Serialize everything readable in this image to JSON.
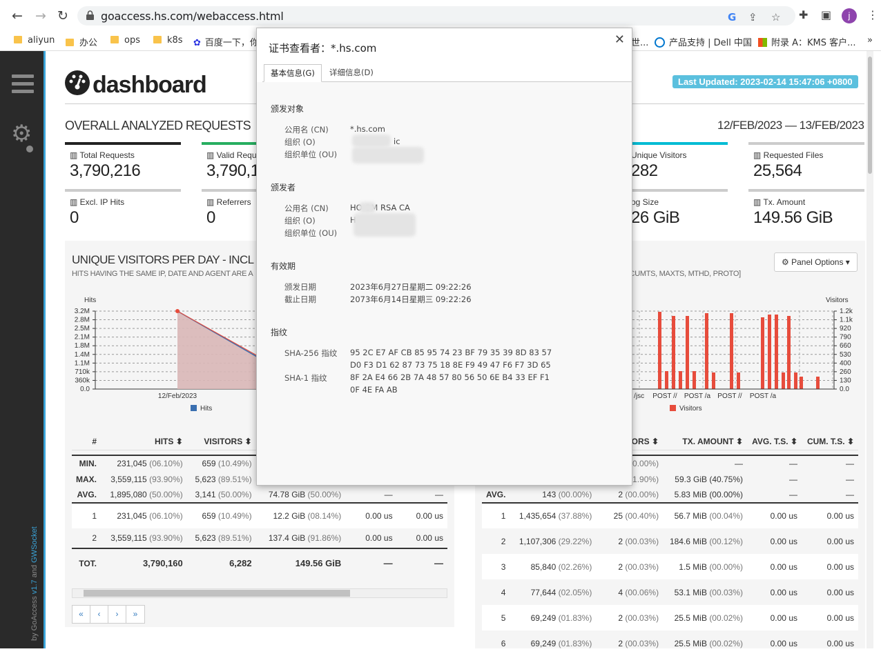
{
  "browser": {
    "url": "goaccess.hs.com/webaccess.html",
    "avatar_letter": "j",
    "bookmarks": [
      "aliyun",
      "办公",
      "ops",
      "k8s",
      "百度一下，你",
      "世...",
      "产品支持 | Dell 中国",
      "附录 A：KMS 客户..."
    ],
    "more_bookmarks": "»"
  },
  "sidebar": {
    "footer_prefix": "by GoAccess ",
    "footer_version": "v1.7",
    "footer_mid": " and ",
    "footer_ws": "GWSocket"
  },
  "dashboard": {
    "brand": "dashboard",
    "last_updated": "Last Updated: 2023-02-14 15:47:06 +0800",
    "section_title": "OVERALL ANALYZED REQUESTS",
    "date_range": "12/FEB/2023 — 13/FEB/2023",
    "cards": [
      {
        "label": "Total Requests",
        "value": "3,790,216",
        "color": "#222222"
      },
      {
        "label": "Valid Requ",
        "value": "3,790,1",
        "color": "#27ae60"
      },
      {
        "label": "Unique Visitors",
        "value": "282",
        "color": "#00bcd4"
      },
      {
        "label": "Requested Files",
        "value": "25,564",
        "color": "#aaaaaa"
      },
      {
        "label": "Excl. IP Hits",
        "value": "0",
        "color": "#aaaaaa"
      },
      {
        "label": "Referrers",
        "value": "0",
        "color": "#aaaaaa"
      },
      {
        "label": "og Size",
        "value": "26 GiB",
        "color": "#aaaaaa"
      },
      {
        "label": "Tx. Amount",
        "value": "149.56 GiB",
        "color": "#aaaaaa"
      }
    ],
    "panel_options": "Panel Options ▾"
  },
  "left_panel": {
    "title": "UNIQUE VISITORS PER DAY - INCL",
    "subtitle": "HITS HAVING THE SAME IP, DATE AND AGENT ARE A",
    "y_axis_label": "Hits",
    "legend": "Hits",
    "columns": [
      "#",
      "HITS ⬍",
      "VISITORS ⬍"
    ],
    "summary": [
      {
        "label": "MIN.",
        "hits": "231,045",
        "hits_pct": "(06.10%)",
        "visitors": "659",
        "visitors_pct": "(10.49%)",
        "tx": "",
        "tx_pct": "",
        "avg": "",
        "cum": ""
      },
      {
        "label": "MAX.",
        "hits": "3,559,115",
        "hits_pct": "(93.90%)",
        "visitors": "5,623",
        "visitors_pct": "(89.51%)",
        "tx": "",
        "tx_pct": "",
        "avg": "",
        "cum": ""
      },
      {
        "label": "AVG.",
        "hits": "1,895,080",
        "hits_pct": "(50.00%)",
        "visitors": "3,141",
        "visitors_pct": "(50.00%)",
        "tx": "74.78 GiB",
        "tx_pct": "(50.00%)",
        "avg": "—",
        "cum": "—"
      }
    ],
    "rows": [
      {
        "n": "1",
        "hits": "231,045",
        "hits_pct": "(06.10%)",
        "visitors": "659",
        "visitors_pct": "(10.49%)",
        "tx": "12.2 GiB",
        "tx_pct": "(08.14%)",
        "avg": "0.00 us",
        "cum": "0.00 us"
      },
      {
        "n": "2",
        "hits": "3,559,115",
        "hits_pct": "(93.90%)",
        "visitors": "5,623",
        "visitors_pct": "(89.51%)",
        "tx": "137.4 GiB",
        "tx_pct": "(91.86%)",
        "avg": "0.00 us",
        "cum": "0.00 us"
      }
    ],
    "total": {
      "label": "TOT.",
      "hits": "3,790,160",
      "visitors": "6,282",
      "tx": "149.56 GiB",
      "avg": "—",
      "cum": "—"
    },
    "pager": [
      "«",
      "‹",
      "›",
      "»"
    ]
  },
  "right_panel": {
    "subtitle": "S, CUMTS, MAXTS, MTHD, PROTO]",
    "y_axis_label": "Visitors",
    "legend": "Visitors",
    "columns": [
      "TORS ⬍",
      "TX. AMOUNT ⬍",
      "AVG. T.S. ⬍",
      "CUM. T.S. ⬍"
    ],
    "summary": [
      {
        "label": "",
        "hits": "",
        "hits_pct": "",
        "visitors": "",
        "visitors_pct": "00.00%)",
        "tx": "—",
        "avg": "—",
        "cum": "—"
      },
      {
        "label": "",
        "hits": "",
        "hits_pct": "",
        "visitors": "",
        "visitors_pct": "01.90%)",
        "tx": "59.3 GiB (40.75%)",
        "avg": "—",
        "cum": "—"
      },
      {
        "label": "AVG.",
        "hits": "143",
        "hits_pct": "(00.00%)",
        "visitors": "2",
        "visitors_pct": "(00.00%)",
        "tx": "5.83 MiB (00.00%)",
        "avg": "—",
        "cum": "—"
      }
    ],
    "rows": [
      {
        "n": "1",
        "hits": "1,435,654",
        "hits_pct": "(37.88%)",
        "visitors": "25",
        "visitors_pct": "(00.40%)",
        "tx": "56.7 MiB",
        "tx_pct": "(00.04%)",
        "avg": "0.00 us",
        "cum": "0.00 us"
      },
      {
        "n": "2",
        "hits": "1,107,306",
        "hits_pct": "(29.22%)",
        "visitors": "2",
        "visitors_pct": "(00.03%)",
        "tx": "184.6 MiB",
        "tx_pct": "(00.12%)",
        "avg": "0.00 us",
        "cum": "0.00 us"
      },
      {
        "n": "3",
        "hits": "85,840",
        "hits_pct": "(02.26%)",
        "visitors": "2",
        "visitors_pct": "(00.03%)",
        "tx": "1.5 MiB",
        "tx_pct": "(00.00%)",
        "avg": "0.00 us",
        "cum": "0.00 us"
      },
      {
        "n": "4",
        "hits": "77,644",
        "hits_pct": "(02.05%)",
        "visitors": "4",
        "visitors_pct": "(00.06%)",
        "tx": "53.1 MiB",
        "tx_pct": "(00.03%)",
        "avg": "0.00 us",
        "cum": "0.00 us"
      },
      {
        "n": "5",
        "hits": "69,249",
        "hits_pct": "(01.83%)",
        "visitors": "2",
        "visitors_pct": "(00.03%)",
        "tx": "25.5 MiB",
        "tx_pct": "(00.02%)",
        "avg": "0.00 us",
        "cum": "0.00 us"
      },
      {
        "n": "6",
        "hits": "69,249",
        "hits_pct": "(01.83%)",
        "visitors": "2",
        "visitors_pct": "(00.03%)",
        "tx": "25.5 MiB",
        "tx_pct": "(00.02%)",
        "avg": "0.00 us",
        "cum": "0.00 us"
      }
    ]
  },
  "chart_data": [
    {
      "type": "area",
      "ylabel": "Hits",
      "x": [
        "12/Feb/2023"
      ],
      "yticks": [
        "0.0",
        "360k",
        "710k",
        "1.1M",
        "1.4M",
        "1.8M",
        "2.1M",
        "2.5M",
        "2.8M",
        "3.2M"
      ],
      "ylim": [
        0,
        3559115
      ],
      "series": [
        {
          "name": "Hits",
          "values": [
            3559115
          ],
          "color": "#e74c3c"
        }
      ]
    },
    {
      "type": "bar",
      "ylabel": "Visitors",
      "categories": [
        "ET /jsc",
        "POST //",
        "POST /a",
        "POST //",
        "POST /a"
      ],
      "yticks": [
        "0.0",
        "130",
        "260",
        "400",
        "530",
        "660",
        "790",
        "920",
        "1.1k",
        "1.2k"
      ],
      "ylim": [
        0,
        1300
      ],
      "series": [
        {
          "name": "Visitors",
          "values": [],
          "color": "#e74c3c"
        }
      ]
    }
  ],
  "cert_dialog": {
    "title": "证书查看者：*.hs.com",
    "close": "✕",
    "tabs": [
      "基本信息(G)",
      "详细信息(D)"
    ],
    "issued_to_heading": "颁发对象",
    "issued_to": [
      {
        "k": "公用名 (CN)",
        "v": "*.hs.com"
      },
      {
        "k": "组织 (O)",
        "v": "ic"
      },
      {
        "k": "组织单位 (OU)",
        "v": ""
      }
    ],
    "issuer_heading": "颁发者",
    "issuer": [
      {
        "k": "公用名 (CN)",
        "v": "HO  OM RSA CA"
      },
      {
        "k": "组织 (O)",
        "v": "H"
      },
      {
        "k": "组织单位 (OU)",
        "v": ""
      }
    ],
    "validity_heading": "有效期",
    "validity": [
      {
        "k": "颁发日期",
        "v": "2023年6月27日星期二 09:22:26"
      },
      {
        "k": "截止日期",
        "v": "2073年6月14日星期三 09:22:26"
      }
    ],
    "fingerprint_heading": "指纹",
    "fingerprints": [
      {
        "k": "SHA-256 指纹",
        "v1": "95 2C E7 AF CB 85 95 74 23 BF 79 35 39 8D 83 57",
        "v2": "D0 F3 D1 62 87 73 75 18 8E F9 49 47 F6 F7 3D 65"
      },
      {
        "k": "SHA-1 指纹",
        "v1": "8F 2A E4 66 2B 7A 48 57 80 56 50 6E B4 33 EF F1",
        "v2": "0F 4E FA AB"
      }
    ]
  }
}
